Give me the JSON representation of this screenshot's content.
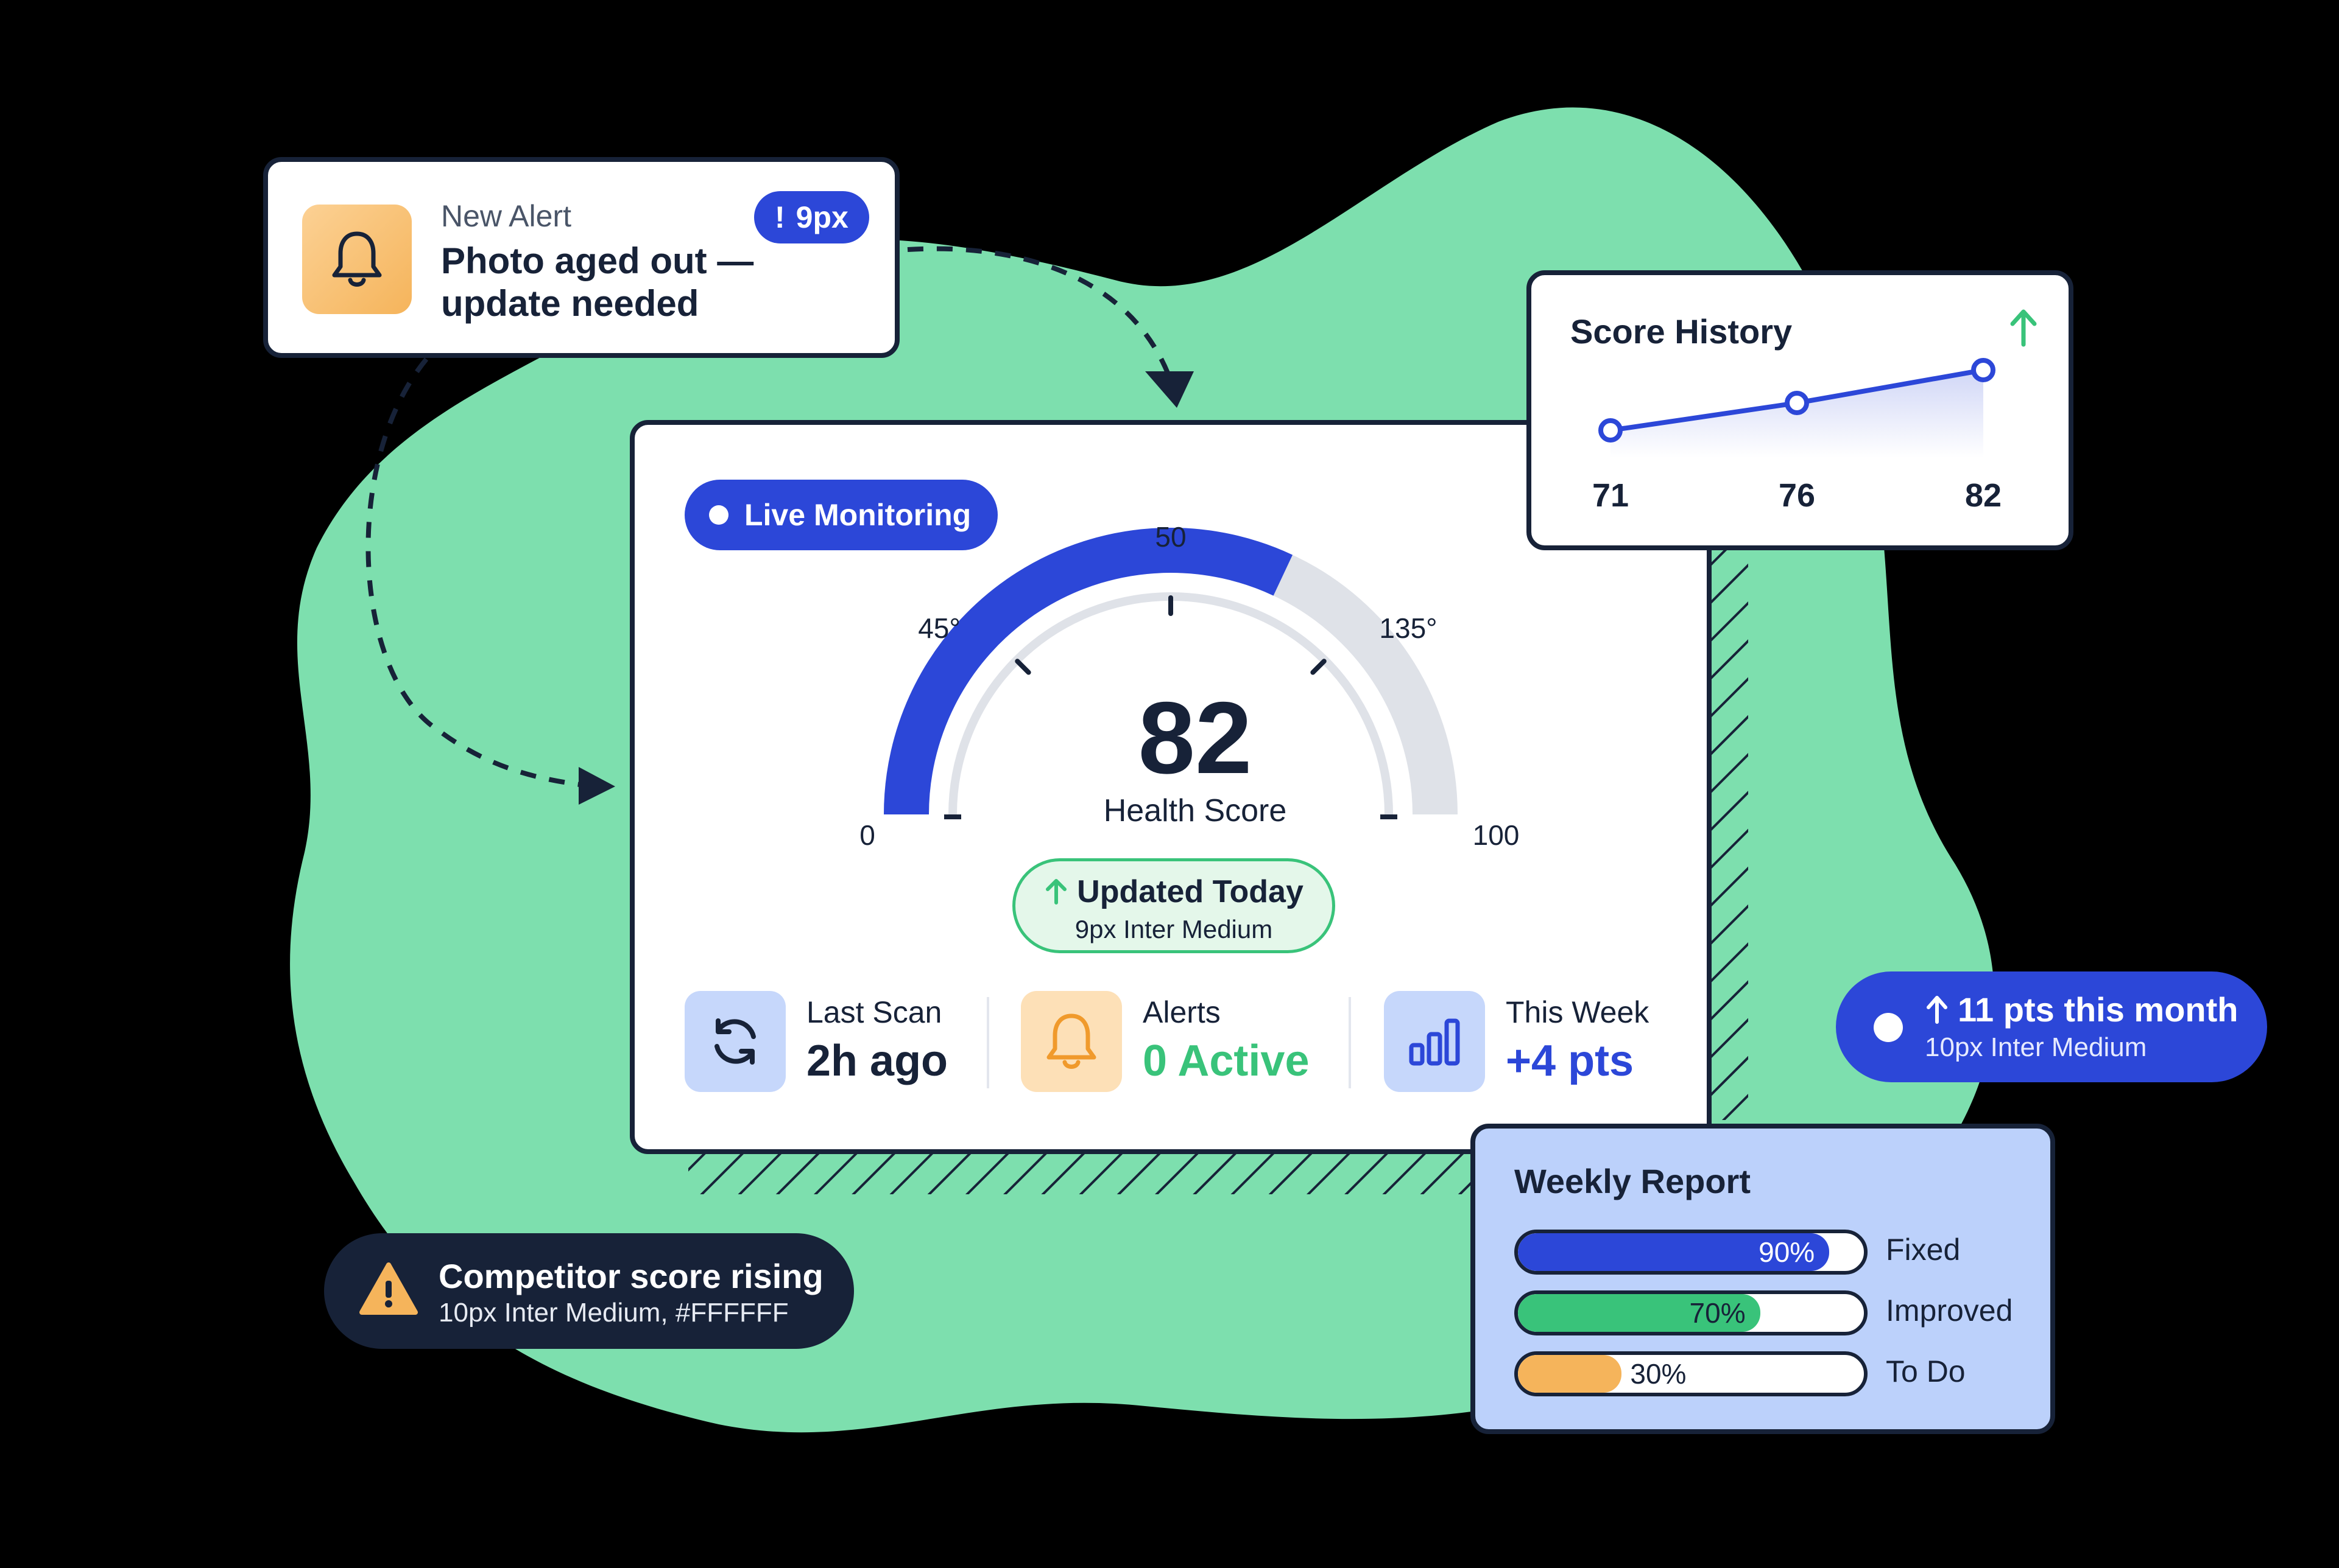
{
  "colors": {
    "background": "#000000",
    "blob": "#7ddfae",
    "primary": "#2c47d8",
    "navy": "#172238",
    "success": "#39c37a",
    "warning": "#f5b45b",
    "track": "#dfe2e8"
  },
  "alert": {
    "eyebrow": "New Alert",
    "title": "Photo aged out — update needed",
    "badge_icon": "!",
    "badge_text": "9px",
    "icon": "bell-icon"
  },
  "score_history": {
    "title": "Score History",
    "trend_icon": "arrow-up-icon",
    "points": [
      {
        "label": "71",
        "value": 71
      },
      {
        "label": "76",
        "value": 76
      },
      {
        "label": "82",
        "value": 82
      }
    ]
  },
  "main": {
    "live_label": "Live Monitoring",
    "gauge": {
      "min_label": "0",
      "mid_label": "50",
      "max_label": "100",
      "left_angle_label": "45°",
      "right_angle_label": "135°",
      "value": 82,
      "min": 0,
      "max": 100,
      "score_text": "82",
      "score_label": "Health Score"
    },
    "updated": {
      "title": "Updated Today",
      "subtitle": "9px Inter Medium",
      "icon": "arrow-up-icon"
    },
    "stats": [
      {
        "label": "Last Scan",
        "value": "2h ago",
        "icon": "refresh-icon",
        "value_color": "#172238"
      },
      {
        "label": "Alerts",
        "value": "0 Active",
        "icon": "bell-icon",
        "value_color": "#39c37a"
      },
      {
        "label": "This Week",
        "value": "+4 pts",
        "icon": "bar-chart-icon",
        "value_color": "#2c47d8"
      }
    ]
  },
  "month": {
    "title": "11 pts this month",
    "subtitle": "10px Inter Medium",
    "icon": "arrow-up-icon"
  },
  "competitor": {
    "title": "Competitor score rising",
    "subtitle": "10px Inter Medium, #FFFFFF",
    "icon": "warning-icon"
  },
  "weekly_report": {
    "title": "Weekly Report",
    "rows": [
      {
        "pct_label": "90%",
        "value": 90,
        "label": "Fixed",
        "color": "#2c47d8"
      },
      {
        "pct_label": "70%",
        "value": 70,
        "label": "Improved",
        "color": "#39c37a"
      },
      {
        "pct_label": "30%",
        "value": 30,
        "label": "To Do",
        "color": "#f5b45b"
      }
    ]
  }
}
